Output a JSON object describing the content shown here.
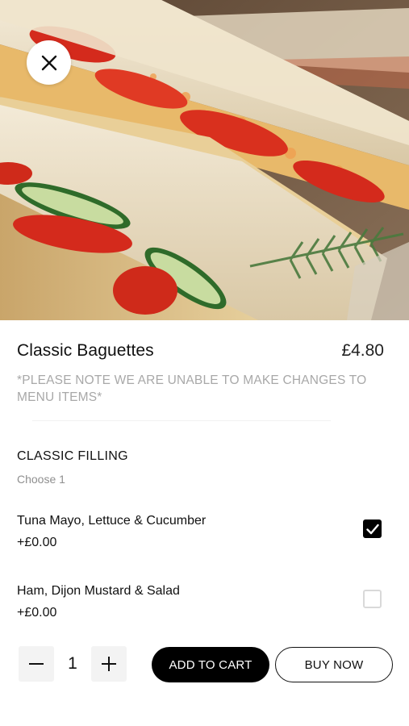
{
  "hero": {
    "image_description": "Close-up photo of baguette sandwiches with tomato, cucumber and coleslaw filling",
    "close_icon": "close-icon"
  },
  "product": {
    "title": "Classic Baguettes",
    "price": "£4.80",
    "note": "*PLEASE NOTE WE ARE UNABLE TO MAKE CHANGES TO MENU ITEMS*"
  },
  "section": {
    "title": "CLASSIC FILLING",
    "subtitle": "Choose 1"
  },
  "options": [
    {
      "name": "Tuna Mayo, Lettuce & Cucumber",
      "price": "+£0.00",
      "selected": true
    },
    {
      "name": "Ham, Dijon Mustard & Salad",
      "price": "+£0.00",
      "selected": false
    }
  ],
  "cart": {
    "quantity": "1",
    "decrement_icon": "minus-icon",
    "increment_icon": "plus-icon",
    "add_to_cart_label": "ADD TO CART",
    "buy_now_label": "BUY NOW"
  },
  "colors": {
    "primary": "#000000",
    "muted_text": "#a8a8a8",
    "stepper_bg": "#f3f3f3"
  }
}
